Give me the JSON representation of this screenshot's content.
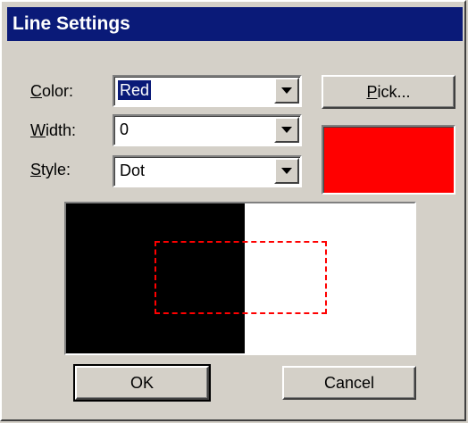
{
  "dialog": {
    "title": "Line Settings"
  },
  "fields": {
    "color": {
      "label_prefix": "",
      "label_accel": "C",
      "label_rest": "olor:",
      "value": "Red"
    },
    "width": {
      "label_accel": "W",
      "label_rest": "idth:",
      "value": "0"
    },
    "style": {
      "label_accel": "S",
      "label_rest": "tyle:",
      "value": "Dot"
    }
  },
  "buttons": {
    "pick_accel": "P",
    "pick_rest": "ick...",
    "ok": "OK",
    "cancel": "Cancel"
  },
  "colors": {
    "swatch": "#ff0000",
    "preview_dark": "#000000",
    "preview_light": "#ffffff",
    "line": "#ff0000",
    "titlebar": "#0a1a78"
  },
  "preview": {
    "line_style": "dot",
    "line_width": "0"
  }
}
